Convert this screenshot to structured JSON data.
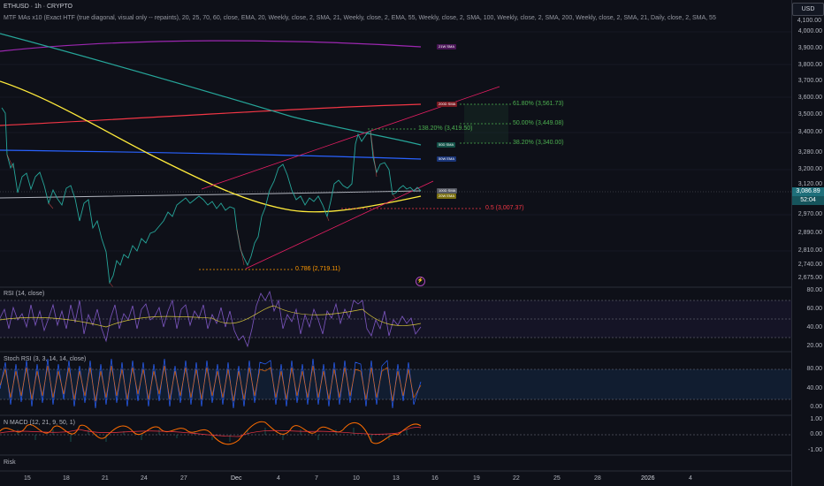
{
  "header": {
    "symbol_line": "ETHUSD · 1h · CRYPTO",
    "indicator_line": "MTF MAs x10 (Exact HTF (true diagonal, visual only -- repaints), 20, 25, 70, 60, close, EMA, 20, Weekly, close, 2, SMA, 21, Weekly, close, 2, EMA, 55, Weekly, close, 2, SMA, 100, Weekly, close, 2, SMA, 200, Weekly, close, 2, SMA, 21, Daily, close, 2, SMA, 55"
  },
  "currency": "USD",
  "price_axis": [
    "4,100.00",
    "4,000.00",
    "3,900.00",
    "3,800.00",
    "3,700.00",
    "3,600.00",
    "3,500.00",
    "3,400.00",
    "3,280.00",
    "3,200.00",
    "3,120.00",
    "2,970.00",
    "2,890.00",
    "2,810.00",
    "2,740.00",
    "2,675.00"
  ],
  "last_price": "3,086.89",
  "countdown": "52:04",
  "ma_tags": {
    "w21": "21W SMA",
    "d200": "200D SMA",
    "d50": "50D SMA",
    "w50": "50W EMA",
    "d100": "100D SMA",
    "w20": "20W EMA"
  },
  "fib_labels": {
    "f618": "61.80% (3,561.73)",
    "f1382": "138.20% (3,419.50)",
    "f50": "50.00% (3,449.08)",
    "f382": "38.20% (3,340.00)",
    "f05": "0.5 (3,007.37)",
    "f786": "0.786 (2,719.11)"
  },
  "panes": {
    "rsi_title": "RSI (14, close)",
    "rsi_axis": [
      "80.00",
      "60.00",
      "40.00",
      "20.00"
    ],
    "stoch_title": "Stoch RSI (3, 3, 14, 14, close)",
    "stoch_axis": [
      "80.00",
      "40.00",
      "0.00"
    ],
    "macd_title": "N MACD (12, 21, 9, 50, 1)",
    "macd_axis": [
      "1.00",
      "0.00",
      "-1.00"
    ],
    "risk_title": "Risk"
  },
  "time_axis": [
    "15",
    "18",
    "21",
    "24",
    "27",
    "Dec",
    "4",
    "7",
    "10",
    "13",
    "16",
    "19",
    "22",
    "25",
    "28",
    "2026",
    "4"
  ],
  "colors": {
    "bull": "#26a69a",
    "bear": "#ef5350",
    "ma_purple": "#9c27b0",
    "ma_red": "#f23645",
    "ma_teal": "#26a69a",
    "ma_blue": "#2962ff",
    "ma_yellow": "#ffeb3b",
    "ma_white": "#b2b5be",
    "fib_green": "#4caf50",
    "fib_red": "#f23645",
    "fib_orange": "#ff9800",
    "rsi_line": "#7e57c2",
    "macd_orange": "#ff6d00"
  }
}
